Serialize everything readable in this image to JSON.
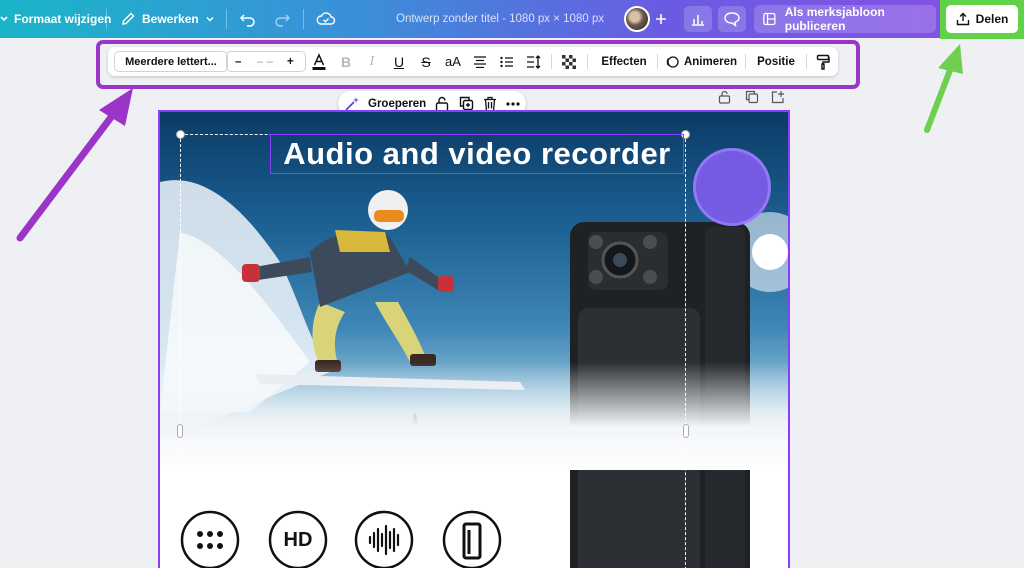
{
  "topbar": {
    "resize_label": "Formaat wijzigen",
    "edit_label": "Bewerken",
    "design_title": "Ontwerp zonder titel - 1080 px × 1080 px",
    "publish_label": "Als merksjabloon publiceren",
    "share_label": "Delen"
  },
  "text_toolbar": {
    "font_name": "Meerdere lettert...",
    "size_minus": "–",
    "size_value": "– –",
    "size_plus": "+",
    "case_label": "aA",
    "effects_label": "Effecten",
    "animate_label": "Animeren",
    "position_label": "Positie"
  },
  "element_toolbar": {
    "group_label": "Groeperen"
  },
  "canvas": {
    "headline": "Audio and video recorder",
    "feature_hd_label": "HD"
  },
  "colors": {
    "accent_purple": "#8b3dff",
    "highlight_outline": "#9b35c8",
    "highlight_green": "#5fd24a"
  }
}
